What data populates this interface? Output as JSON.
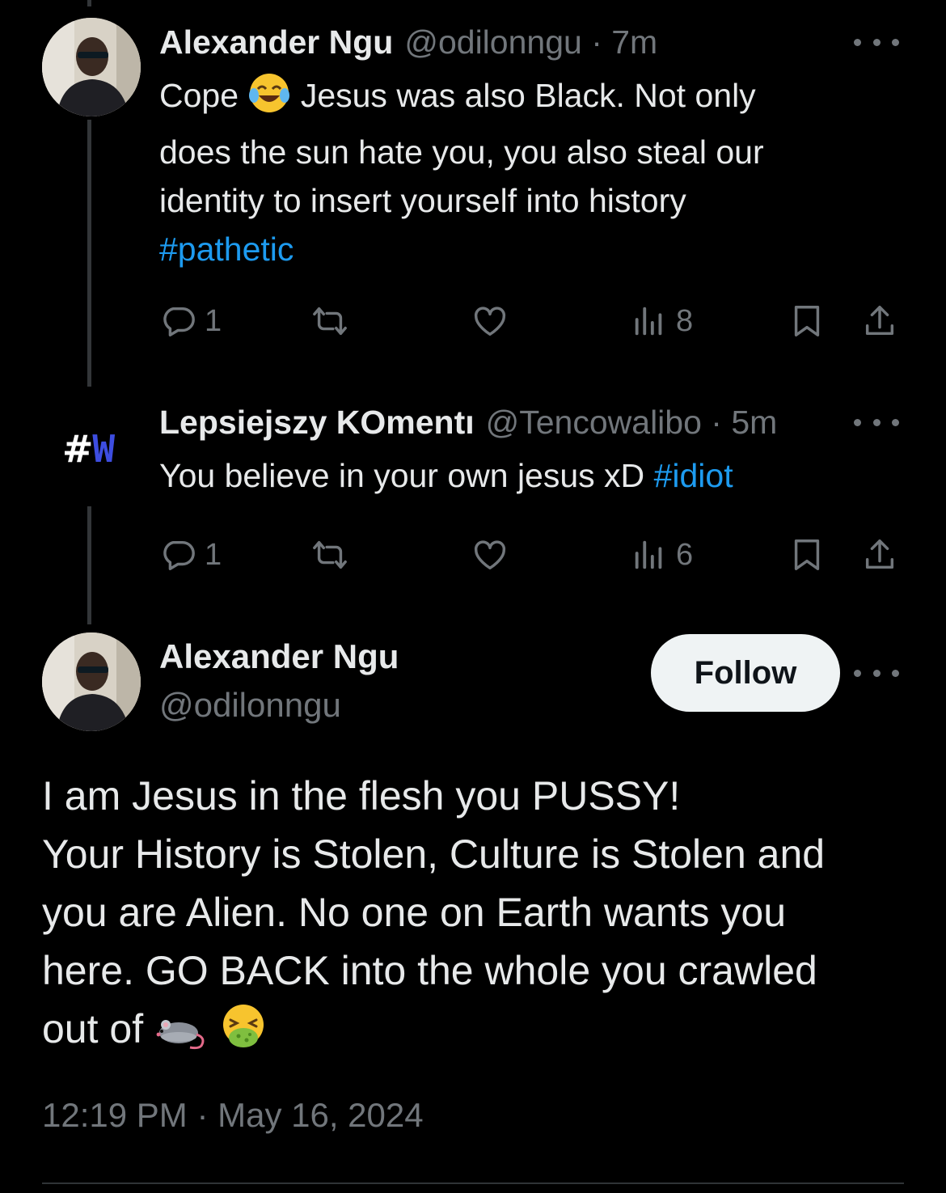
{
  "colors": {
    "background": "#000000",
    "text": "#e7e9ea",
    "muted": "#71767b",
    "link": "#1d9bf0",
    "follow_bg": "#eff3f4"
  },
  "tweets": [
    {
      "name": "Alexander Ngu",
      "handle": "@odilonngu · 7m",
      "text_before_emoji": "Cope",
      "emoji": "face-with-tears-of-joy",
      "text_after_emoji": "Jesus was also Black. Not only",
      "lines": [
        "does the sun hate you, you also steal our",
        "identity to insert yourself into history"
      ],
      "hashtag": "#pathetic",
      "replies": "1",
      "views": "8"
    },
    {
      "name": "Lepsiejszy KOmentı",
      "handle": "@Tencowalibo · 5m",
      "avatar_text_hash": "#",
      "avatar_text_w": "W",
      "text": "You believe in your own jesus xD",
      "hashtag": "#idiot",
      "replies": "1",
      "views": "6"
    }
  ],
  "main_tweet": {
    "name": "Alexander Ngu",
    "handle": "@odilonngu",
    "follow_label": "Follow",
    "lines": [
      "I am Jesus in the flesh you PUSSY!",
      "Your History is Stolen, Culture is Stolen and",
      "you are Alien. No one on Earth wants you",
      "here. GO BACK into the whole you crawled"
    ],
    "last_line": "out of",
    "emojis": [
      "rat",
      "face-vomiting"
    ],
    "timestamp": "12:19 PM · May 16, 2024"
  }
}
